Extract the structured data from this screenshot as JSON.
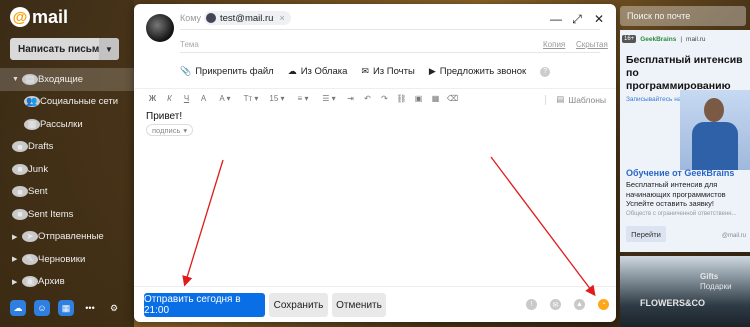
{
  "sidebar": {
    "logo_text": "mail",
    "compose_label": "Написать письмо",
    "folders": [
      {
        "label": "Входящие",
        "icon": "inbox-icon",
        "active": true,
        "chevron": true
      },
      {
        "label": "Социальные сети",
        "icon": "people-icon",
        "sub": true
      },
      {
        "label": "Рассылки",
        "icon": "newsletter-icon",
        "sub": true
      },
      {
        "label": "Drafts",
        "icon": "folder-icon"
      },
      {
        "label": "Junk",
        "icon": "folder-icon"
      },
      {
        "label": "Sent",
        "icon": "folder-icon"
      },
      {
        "label": "Sent Items",
        "icon": "folder-icon"
      },
      {
        "label": "Отправленные",
        "icon": "send-icon",
        "chevron": true
      },
      {
        "label": "Черновики",
        "icon": "draft-icon",
        "chevron": true
      },
      {
        "label": "Архив",
        "icon": "archive-icon",
        "chevron": true
      }
    ]
  },
  "compose": {
    "to_label": "Кому",
    "recipient": "test@mail.ru",
    "subject_label": "Тема",
    "cc_label": "Копия",
    "bcc_label": "Скрытая",
    "attach_file": "Прикрепить файл",
    "from_cloud": "Из Облака",
    "from_mail": "Из Почты",
    "invite_call": "Предложить звонок",
    "font_size": "15",
    "templates_label": "Шаблоны",
    "body": "Привет!",
    "signature": "подпись",
    "send_label": "Отправить сегодня в 21:00",
    "save_label": "Сохранить",
    "cancel_label": "Отменить"
  },
  "right": {
    "search_placeholder": "Поиск по почте",
    "ad": {
      "tag": "16+",
      "brand1": "GeekBrains",
      "brand2": "mail.ru",
      "title": "Бесплатный интенсив по программированию",
      "subtitle": "Записывайтесь на сайте",
      "heading": "Обучение от GeekBrains",
      "text": "Бесплатный интенсив для начинающих программистов Успейте оставить заявку!",
      "small": "Обществ с ограниченной ответственн...",
      "button": "Перейти",
      "mark": "@mail.ru"
    },
    "ad2": {
      "sign1": "Gifts",
      "sign2": "FLOWERS&CO",
      "sign3": "Подарки"
    }
  },
  "colors": {
    "send": "#0a6fe6",
    "arrow": "#e01b1b",
    "clock": "#ffa71a"
  }
}
